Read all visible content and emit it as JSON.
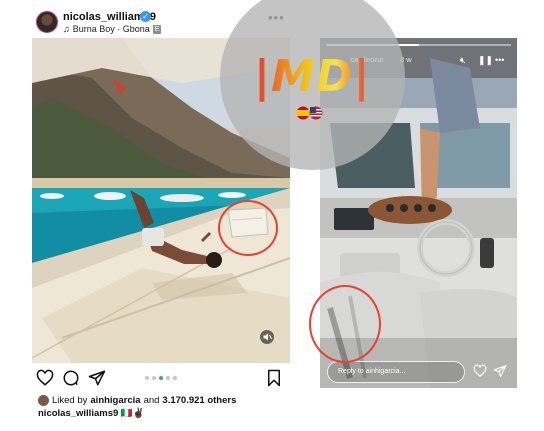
{
  "post": {
    "username": "nicolas_williams9",
    "audio": "Burna Boy · Gbona",
    "explicit_badge": "E",
    "more_icon": "more-dots-icon",
    "likes_prefix": "Liked by",
    "liked_by_user": "ainhigarcia",
    "likes_and": "and",
    "likes_count": "3.170.921 others",
    "caption_user": "nicolas_williams9",
    "caption_text": "🇮🇹✌🏿",
    "carousel_total": 5,
    "carousel_active_index": 2,
    "icons": [
      "heart-icon",
      "comment-icon",
      "share-icon",
      "bookmark-icon",
      "mute-icon"
    ]
  },
  "story": {
    "username": "cardeona",
    "time": "8 w",
    "reply_placeholder": "Reply to ainhigarcia...",
    "progress_fraction": 0.5,
    "controls": [
      "mute-icon",
      "pause-icon",
      "more-icon"
    ]
  },
  "watermark": {
    "logo_text": "|MD|",
    "flags": "spain-us-flags"
  },
  "colors": {
    "annotation_red": "#e7422e",
    "verified_blue": "#3897f0",
    "carousel_active": "#3897f0"
  }
}
